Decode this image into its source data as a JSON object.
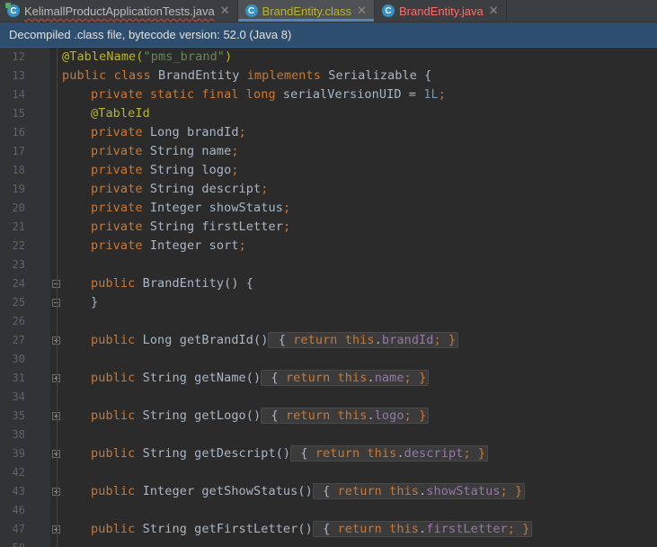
{
  "tabs": [
    {
      "label": "KelimallProductApplicationTests.java",
      "icon": "test-class-icon",
      "color": "#bbbbbb",
      "active": false
    },
    {
      "label": "BrandEntity.class",
      "icon": "class-icon",
      "color": "#bbb529",
      "active": true
    },
    {
      "label": "BrandEntity.java",
      "icon": "class-icon",
      "color": "#ff6b68",
      "active": false
    }
  ],
  "banner": {
    "text": "Decompiled .class file, bytecode version: 52.0 (Java 8)"
  },
  "code": {
    "lines": [
      {
        "no": "12"
      },
      {
        "no": "13"
      },
      {
        "no": "14"
      },
      {
        "no": "15"
      },
      {
        "no": "16"
      },
      {
        "no": "17"
      },
      {
        "no": "18"
      },
      {
        "no": "19"
      },
      {
        "no": "20"
      },
      {
        "no": "21"
      },
      {
        "no": "22"
      },
      {
        "no": "23"
      },
      {
        "no": "24"
      },
      {
        "no": "25"
      },
      {
        "no": "26"
      },
      {
        "no": "27"
      },
      {
        "no": "30"
      },
      {
        "no": "31"
      },
      {
        "no": "34"
      },
      {
        "no": "35"
      },
      {
        "no": "38"
      },
      {
        "no": "39"
      },
      {
        "no": "42"
      },
      {
        "no": "43"
      },
      {
        "no": "46"
      },
      {
        "no": "47"
      },
      {
        "no": "50"
      }
    ],
    "tokens": {
      "l12": [
        "@TableName(",
        "\"pms_brand\"",
        ")"
      ],
      "l13": [
        "public class ",
        "BrandEntity ",
        "implements ",
        "Serializable {"
      ],
      "l14": [
        "private static final long ",
        "serialVersionUID",
        " = ",
        "1L",
        ";"
      ],
      "l15": [
        "@TableId"
      ],
      "l16": [
        "private ",
        "Long brandId",
        ";"
      ],
      "l17": [
        "private ",
        "String name",
        ";"
      ],
      "l18": [
        "private ",
        "String logo",
        ";"
      ],
      "l19": [
        "private ",
        "String descript",
        ";"
      ],
      "l20": [
        "private ",
        "Integer showStatus",
        ";"
      ],
      "l21": [
        "private ",
        "String firstLetter",
        ";"
      ],
      "l22": [
        "private ",
        "Integer sort",
        ";"
      ],
      "l24": [
        "public ",
        "BrandEntity() {"
      ],
      "l25": [
        "}"
      ],
      "l27": [
        "public ",
        "Long getBrandId()",
        " { ",
        "return this",
        ".",
        "brandId",
        "; }"
      ],
      "l31": [
        "public ",
        "String getName()",
        " { ",
        "return this",
        ".",
        "name",
        "; }"
      ],
      "l35": [
        "public ",
        "String getLogo()",
        " { ",
        "return this",
        ".",
        "logo",
        "; }"
      ],
      "l39": [
        "public ",
        "String getDescript()",
        " { ",
        "return this",
        ".",
        "descript",
        "; }"
      ],
      "l43": [
        "public ",
        "Integer getShowStatus()",
        " { ",
        "return this",
        ".",
        "showStatus",
        "; }"
      ],
      "l47": [
        "public ",
        "String getFirstLetter()",
        " { ",
        "return this",
        ".",
        "firstLetter",
        "; }"
      ]
    }
  },
  "colors": {
    "keyword": "#cc7832",
    "string": "#6a8759",
    "number": "#6897bb",
    "annotation": "#bbb529",
    "field": "#9876aa",
    "default": "#a9b7c6"
  }
}
